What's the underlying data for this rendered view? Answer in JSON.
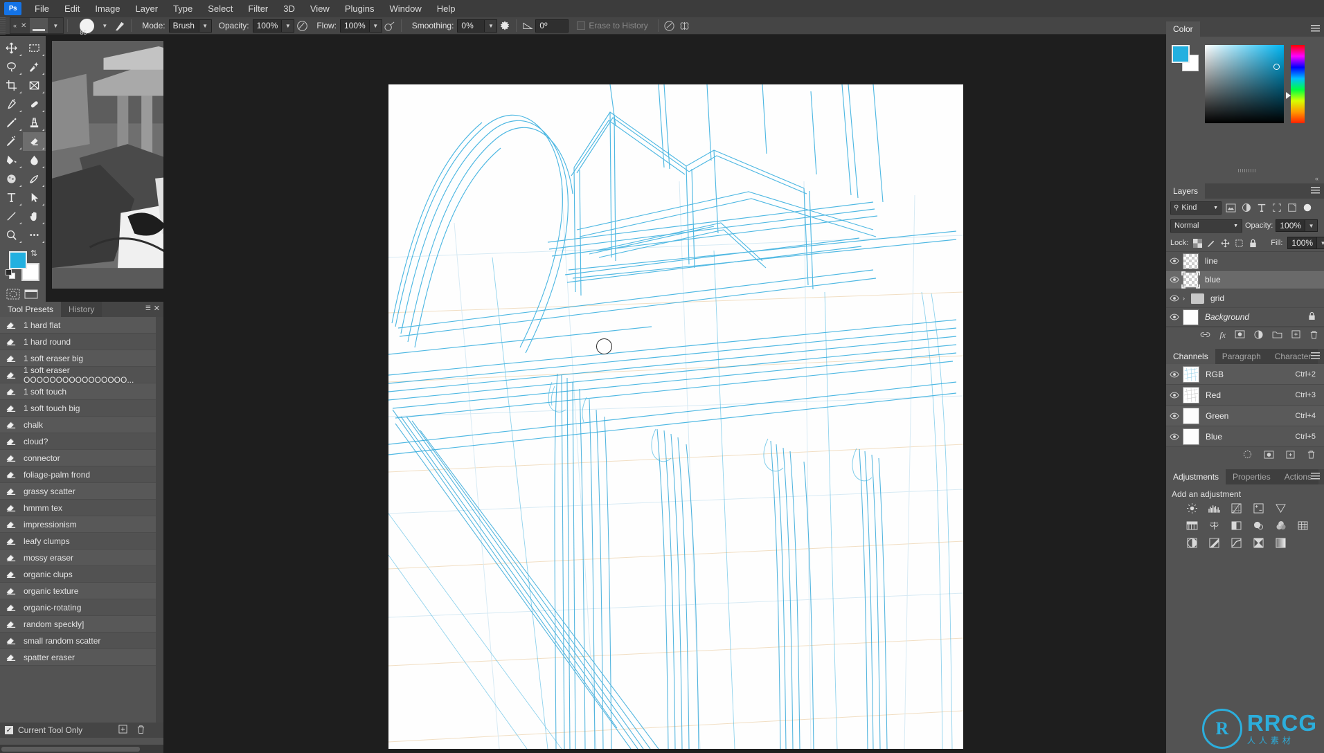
{
  "app": {
    "logo": "Ps",
    "title": "Adobe Photoshop"
  },
  "menubar": {
    "items": [
      "File",
      "Edit",
      "Image",
      "Layer",
      "Type",
      "Select",
      "Filter",
      "3D",
      "View",
      "Plugins",
      "Window",
      "Help"
    ]
  },
  "options_bar": {
    "preset_collapse_icon": "«",
    "preset_close_icon": "✕",
    "brush_size_label": "85",
    "mode_label": "Mode:",
    "mode_value": "Brush",
    "opacity_label": "Opacity:",
    "opacity_value": "100%",
    "pressure_opacity_icon": "pressure-opacity-icon",
    "flow_label": "Flow:",
    "flow_value": "100%",
    "airbrush_icon": "airbrush-icon",
    "smoothing_label": "Smoothing:",
    "smoothing_value": "0%",
    "smoothing_gear_icon": "gear-icon",
    "angle_icon": "brush-angle-icon",
    "angle_value": "0º",
    "erase_to_history_label": "Erase to History",
    "tablet_pressure_size_icon": "tablet-pressure-size-icon",
    "symmetry_icon": "symmetry-butterfly-icon"
  },
  "toolbar": {
    "tools": [
      {
        "name": "move-tool",
        "glyph": "move"
      },
      {
        "name": "rectangular-marquee-tool",
        "glyph": "marquee"
      },
      {
        "name": "lasso-tool",
        "glyph": "lasso"
      },
      {
        "name": "object-selection-tool",
        "glyph": "wand"
      },
      {
        "name": "crop-tool",
        "glyph": "crop"
      },
      {
        "name": "frame-tool",
        "glyph": "frame"
      },
      {
        "name": "eyedropper-tool",
        "glyph": "eyedropper"
      },
      {
        "name": "spot-healing-brush-tool",
        "glyph": "heal"
      },
      {
        "name": "brush-tool",
        "glyph": "brush"
      },
      {
        "name": "clone-stamp-tool",
        "glyph": "stamp"
      },
      {
        "name": "history-brush-tool",
        "glyph": "historybrush"
      },
      {
        "name": "eraser-tool",
        "glyph": "eraser",
        "selected": true
      },
      {
        "name": "gradient-tool",
        "glyph": "bucket"
      },
      {
        "name": "blur-tool",
        "glyph": "blur"
      },
      {
        "name": "dodge-tool",
        "glyph": "sponge"
      },
      {
        "name": "pen-tool",
        "glyph": "pen"
      },
      {
        "name": "horizontal-type-tool",
        "glyph": "type"
      },
      {
        "name": "path-selection-tool",
        "glyph": "arrow"
      },
      {
        "name": "line-tool",
        "glyph": "line"
      },
      {
        "name": "hand-tool",
        "glyph": "hand"
      },
      {
        "name": "zoom-tool",
        "glyph": "zoom"
      },
      {
        "name": "edit-toolbar-tool",
        "glyph": "dots"
      }
    ],
    "foreground_color": "#22b0e0",
    "background_color": "#ffffff",
    "swap_colors_icon": "swap-colors-icon",
    "default_colors_icon": "default-colors-icon",
    "quick_mask_icon": "quick-mask-icon",
    "screen_mode_icon": "screen-mode-icon"
  },
  "tool_presets": {
    "tabs": [
      {
        "label": "Tool Presets",
        "active": true
      },
      {
        "label": "History",
        "active": false
      }
    ],
    "menu_icon": "panel-menu-icon",
    "close_icon": "close-icon",
    "items": [
      "1 hard flat",
      "1 hard round",
      "1 soft eraser big",
      "1 soft eraser  OOOOOOOOOOOOOOOO...",
      "1 soft touch",
      "1 soft touch big",
      "chalk",
      "cloud?",
      "connector",
      "foliage-palm frond",
      "grassy scatter",
      "hmmm tex",
      "impressionism",
      "leafy clumps",
      "mossy eraser",
      "organic clups",
      "organic texture",
      "organic-rotating",
      "random speckly]",
      "small random scatter",
      "spatter eraser"
    ],
    "footer": {
      "current_tool_only_label": "Current Tool Only",
      "current_tool_only_checked": true,
      "new_preset_icon": "new-preset-icon",
      "delete_preset_icon": "trash-icon"
    }
  },
  "color_panel": {
    "tab_label": "Color",
    "menu_icon": "panel-menu-icon",
    "foreground": "#22b0e0",
    "background": "#ffffff",
    "hue_position": "cyan"
  },
  "layers_panel": {
    "tab_label": "Layers",
    "menu_icon": "panel-menu-icon",
    "filter_label": "Kind",
    "filter_icons": [
      "pixel-filter-icon",
      "adjustment-filter-icon",
      "type-filter-icon",
      "shape-filter-icon",
      "smartobject-filter-icon",
      "filter-toggle-icon"
    ],
    "blend_mode": "Normal",
    "opacity_label": "Opacity:",
    "opacity_value": "100%",
    "lock_label": "Lock:",
    "lock_icons": [
      "lock-transparent-pixels-icon",
      "lock-image-pixels-icon",
      "lock-position-icon",
      "lock-artboard-icon",
      "lock-all-icon"
    ],
    "fill_label": "Fill:",
    "fill_value": "100%",
    "layers": [
      {
        "name": "line",
        "visible": true,
        "selected": false,
        "type": "pixel",
        "locked": false
      },
      {
        "name": "blue",
        "visible": true,
        "selected": true,
        "type": "pixel",
        "locked": false
      },
      {
        "name": "grid",
        "visible": true,
        "selected": false,
        "type": "group",
        "locked": false
      },
      {
        "name": "Background",
        "visible": true,
        "selected": false,
        "type": "background",
        "locked": true
      }
    ],
    "footer_icons": [
      "link-layers-icon",
      "layer-style-fx-icon",
      "layer-mask-icon",
      "adjustment-layer-icon",
      "new-group-icon",
      "new-layer-icon",
      "delete-layer-icon"
    ]
  },
  "channels_panel": {
    "tabs": [
      {
        "label": "Channels",
        "active": true
      },
      {
        "label": "Paragraph",
        "active": false
      },
      {
        "label": "Character",
        "active": false
      }
    ],
    "menu_icon": "panel-menu-icon",
    "channels": [
      {
        "name": "RGB",
        "shortcut": "Ctrl+2",
        "visible": true
      },
      {
        "name": "Red",
        "shortcut": "Ctrl+3",
        "visible": true
      },
      {
        "name": "Green",
        "shortcut": "Ctrl+4",
        "visible": true
      },
      {
        "name": "Blue",
        "shortcut": "Ctrl+5",
        "visible": true
      }
    ],
    "footer_icons": [
      "load-channel-as-selection-icon",
      "save-selection-as-channel-icon",
      "new-channel-icon",
      "delete-channel-icon"
    ]
  },
  "adjustments_panel": {
    "tabs": [
      {
        "label": "Adjustments",
        "active": true
      },
      {
        "label": "Properties",
        "active": false
      },
      {
        "label": "Actions",
        "active": false
      }
    ],
    "menu_icon": "panel-menu-icon",
    "heading": "Add an adjustment",
    "rows": [
      [
        "brightness-contrast-icon",
        "levels-icon",
        "curves-icon",
        "exposure-icon",
        "vibrance-icon"
      ],
      [
        "hue-saturation-icon",
        "color-balance-icon",
        "black-white-icon",
        "photo-filter-icon",
        "channel-mixer-icon",
        "color-lookup-icon"
      ],
      [
        "invert-icon",
        "posterize-icon",
        "threshold-icon",
        "selective-color-icon",
        "gradient-map-icon"
      ]
    ]
  },
  "canvas": {
    "document_background": "#ffffff",
    "brush_cursor_diameter_px": "23",
    "artwork_description": "blue perspective sketch of architecture"
  },
  "watermark": {
    "mark": "R",
    "title": "RRCG",
    "subtitle": "人人素材",
    "color": "#29b6e8"
  }
}
